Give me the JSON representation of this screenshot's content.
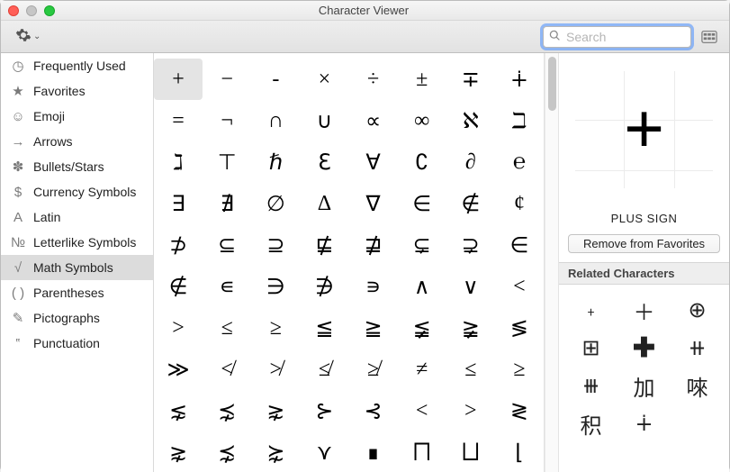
{
  "window": {
    "title": "Character Viewer"
  },
  "search": {
    "placeholder": "Search",
    "value": ""
  },
  "sidebar": {
    "items": [
      {
        "name": "frequently-used",
        "icon": "clock-icon",
        "glyph": "◷",
        "label": "Frequently Used",
        "selected": false
      },
      {
        "name": "favorites",
        "icon": "star-icon",
        "glyph": "★",
        "label": "Favorites",
        "selected": false
      },
      {
        "name": "emoji",
        "icon": "smiley-icon",
        "glyph": "☺",
        "label": "Emoji",
        "selected": false
      },
      {
        "name": "arrows",
        "icon": "arrow-icon",
        "glyph": "→",
        "label": "Arrows",
        "selected": false
      },
      {
        "name": "bullets-stars",
        "icon": "asterisk-icon",
        "glyph": "✽",
        "label": "Bullets/Stars",
        "selected": false
      },
      {
        "name": "currency",
        "icon": "dollar-icon",
        "glyph": "$",
        "label": "Currency Symbols",
        "selected": false
      },
      {
        "name": "latin",
        "icon": "latin-a-icon",
        "glyph": "A",
        "label": "Latin",
        "selected": false
      },
      {
        "name": "letterlike",
        "icon": "letterlike-icon",
        "glyph": "№",
        "label": "Letterlike Symbols",
        "selected": false
      },
      {
        "name": "math",
        "icon": "radical-icon",
        "glyph": "√",
        "label": "Math Symbols",
        "selected": true
      },
      {
        "name": "parentheses",
        "icon": "paren-icon",
        "glyph": "( )",
        "label": "Parentheses",
        "selected": false
      },
      {
        "name": "pictographs",
        "icon": "pencil-icon",
        "glyph": "✎",
        "label": "Pictographs",
        "selected": false
      },
      {
        "name": "punctuation",
        "icon": "punct-icon",
        "glyph": "‟",
        "label": "Punctuation",
        "selected": false
      }
    ]
  },
  "grid": {
    "selected_index": 0,
    "rows": [
      [
        "+",
        "−",
        "-",
        "×",
        "÷",
        "±",
        "∓",
        "∔"
      ],
      [
        "=",
        "¬",
        "∩",
        "∪",
        "∝",
        "∞",
        "ℵ",
        "ℶ"
      ],
      [
        "ℷ",
        "⊤",
        "ℏ",
        "ℇ",
        "∀",
        "∁",
        "∂",
        "℮"
      ],
      [
        "∃",
        "∄",
        "∅",
        "∆",
        "∇",
        "∈",
        "∉",
        "¢"
      ],
      [
        "⊅",
        "⊆",
        "⊇",
        "⋢",
        "⋣",
        "⊊",
        "⊋",
        "∈"
      ],
      [
        "∉",
        "∊",
        "∋",
        "∌",
        "∍",
        "∧",
        "∨",
        "<"
      ],
      [
        ">",
        "≤",
        "≥",
        "≦",
        "≧",
        "≨",
        "≩",
        "≶"
      ],
      [
        "≫",
        "≮",
        "≯",
        "≰",
        "≱",
        "≠",
        "≤",
        "≥"
      ],
      [
        "⋦",
        "⋨",
        "⋧",
        "⊱",
        "⊰",
        "<",
        ">",
        "≷"
      ],
      [
        "⋧",
        "⋨",
        "⋩",
        "⋎",
        "∎",
        "⨅",
        "⨆",
        "⌊"
      ]
    ]
  },
  "detail": {
    "glyph": "+",
    "name": "PLUS SIGN",
    "remove_label": "Remove from Favorites",
    "related_header": "Related Characters",
    "related": [
      "﹢",
      "＋",
      "⊕",
      "⊞",
      "✚",
      "⧺",
      "⧻",
      "加",
      "唻",
      "积",
      "∔",
      ""
    ]
  }
}
